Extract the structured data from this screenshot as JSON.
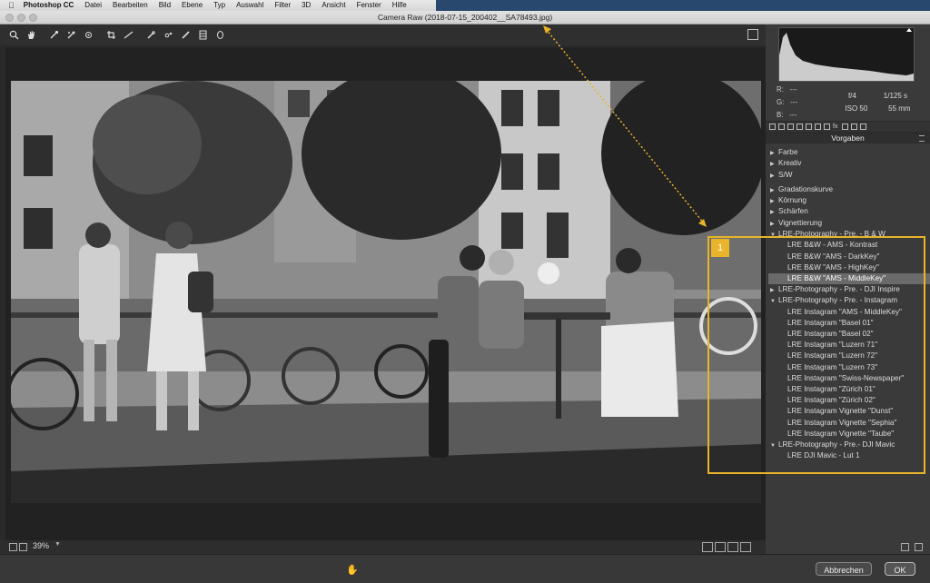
{
  "menubar": {
    "apple": "",
    "items": [
      "Photoshop CC",
      "Datei",
      "Bearbeiten",
      "Bild",
      "Ebene",
      "Typ",
      "Auswahl",
      "Filter",
      "3D",
      "Ansicht",
      "Fenster",
      "Hilfe"
    ]
  },
  "window": {
    "title": "Camera Raw (2018-07-15_200402__SA78493.jpg)"
  },
  "toolbar": {
    "tools": [
      "zoom-icon",
      "hand-icon",
      "white-balance-icon",
      "color-sampler-icon",
      "target-adjust-icon",
      "crop-icon",
      "straighten-icon",
      "spot-removal-icon",
      "red-eye-icon",
      "adjustment-brush-icon",
      "graduated-filter-icon",
      "radial-filter-icon"
    ]
  },
  "status": {
    "zoom": "39%"
  },
  "info": {
    "r_label": "R:",
    "r": "---",
    "g_label": "G:",
    "g": "---",
    "b_label": "B:",
    "b": "---",
    "aperture": "f/4",
    "shutter": "1/125 s",
    "iso": "ISO 50",
    "focal": "55 mm"
  },
  "panel": {
    "title": "Vorgaben"
  },
  "presets": {
    "top_groups": [
      "Farbe",
      "Kreativ",
      "S/W"
    ],
    "groups2": [
      "Gradationskurve",
      "Körnung",
      "Schärfen",
      "Vignettierung"
    ],
    "lre_bw": {
      "label": "LRE-Photography - Pre. - B & W",
      "items": [
        "LRE B&W - AMS - Kontrast",
        "LRE B&W \"AMS - DarkKey\"",
        "LRE B&W \"AMS - HighKey\"",
        "LRE B&W \"AMS - MiddleKey\""
      ]
    },
    "lre_dji_inspire": {
      "label": "LRE-Photography - Pre. - DJI Inspire"
    },
    "lre_instagram": {
      "label": "LRE-Photography - Pre. - Instagram",
      "items": [
        "LRE Instagram \"AMS - MiddleKey\"",
        "LRE Instagram \"Basel 01\"",
        "LRE Instagram \"Basel 02\"",
        "LRE Instagram \"Luzern 71\"",
        "LRE Instagram \"Luzern 72\"",
        "LRE Instagram \"Luzern 73\"",
        "LRE Instagram \"Swiss-Newspaper\"",
        "LRE Instagram \"Zürich 01\"",
        "LRE Instagram \"Zürich 02\"",
        "LRE Instagram Vignette \"Dunst\"",
        "LRE Instagram Vignette \"Sephia\"",
        "LRE Instagram Vignette \"Taube\""
      ]
    },
    "lre_dji_mavic": {
      "label": "LRE-Photography - Pre.- DJI Mavic",
      "items": [
        "LRE DJI Mavic - Lut 1"
      ]
    }
  },
  "annotation": {
    "badge": "1",
    "color": "#e9b42a"
  },
  "buttons": {
    "cancel": "Abbrechen",
    "ok": "OK"
  }
}
